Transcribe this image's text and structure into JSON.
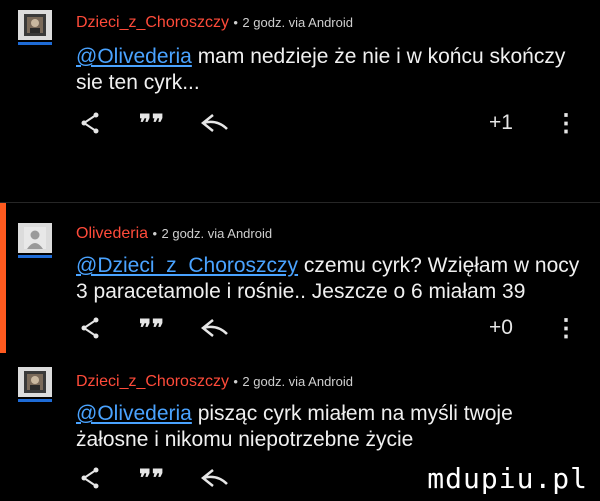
{
  "comments": [
    {
      "author": "Dzieci_z_Choroszczy",
      "separator": "•",
      "time": "2 godz. via Android",
      "mention": "@Olivederia",
      "text": " mam nedzieje że nie i w końcu skończy sie ten cyrk...",
      "votes": "+1",
      "highlighted": false
    },
    {
      "author": "Olivederia",
      "separator": "•",
      "time": "2 godz. via Android",
      "mention": "@Dzieci_z_Choroszczy",
      "text": " czemu cyrk? Wzięłam w nocy 3 paracetamole i rośnie.. Jeszcze o 6 miałam 39",
      "votes": "+0",
      "highlighted": true
    },
    {
      "author": "Dzieci_z_Choroszczy",
      "separator": "•",
      "time": "2 godz. via Android",
      "mention": "@Olivederia",
      "text": " pisząc cyrk miałem na myśli twoje żałosne i nikomu niepotrzebne życie",
      "votes": "",
      "highlighted": false
    }
  ],
  "actions": {
    "share_icon": "share-icon",
    "quote_icon": "quote-icon",
    "quote_glyph": "❞❞",
    "reply_icon": "reply-icon",
    "more_glyph": "⋮"
  },
  "watermark": "mdupiu.pl",
  "colors": {
    "author": "#ff4b3a",
    "mention": "#4aa3ff",
    "highlight_bar": "#ff5a1f",
    "avatar_underline": "#1e6bd6"
  }
}
